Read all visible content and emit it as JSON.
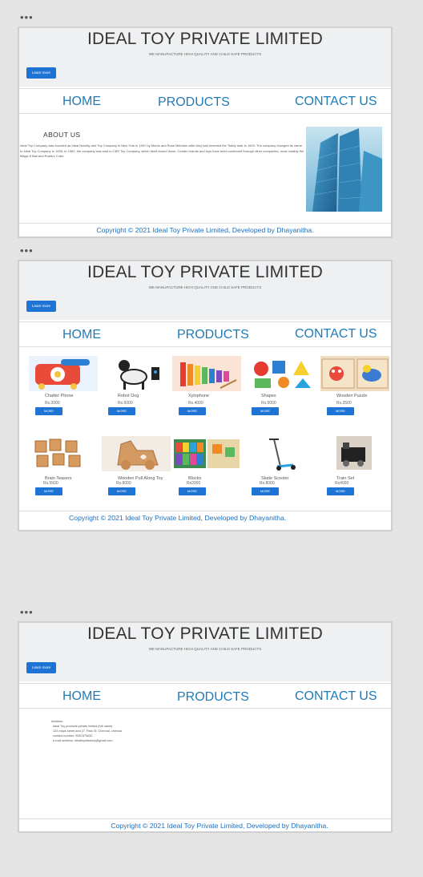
{
  "site": {
    "title": "IDEAL TOY PRIVATE LIMITED",
    "subtitle": "WE MANUFACTURE HIGH QUALITY AND CHILD SAFE PRODUCTS",
    "learn_more": "Learn more",
    "nav": {
      "home": "HOME",
      "products": "PRODUCTS",
      "contact": "CONTACT US"
    },
    "footer": "Copyright © 2021 Ideal Toy Private Limited, Developed by Dhayanitha."
  },
  "window_menu_icon": "more-dots-icon",
  "about": {
    "heading": "ABOUT US",
    "text": "Ideal Toy Company was founded as Ideal Novelty and Toy Company in New York in 1907 by Morris and Rose Michtom after they had invented the Teddy bear in 1903. The company changed its name to Ideal Toy Company in 1938. In 1982, the company was sold to CBS Toy Company, which itself closed down. Certain brands and toys have been continued through other companies, most notably the Magic 8 Ball and Rubik's Cube."
  },
  "products": [
    {
      "name": "Chatter Phone",
      "price": "Rs.2000",
      "more": "MORE",
      "icon": "toy-phone-icon"
    },
    {
      "name": "Robot Dog",
      "price": "Rs.5000",
      "more": "MORE",
      "icon": "robot-dog-icon"
    },
    {
      "name": "Xylophone",
      "price": "Rs.4000",
      "more": "MORE",
      "icon": "xylophone-icon"
    },
    {
      "name": "Shapes",
      "price": "Rs.5000",
      "more": "MORE",
      "icon": "shapes-icon"
    },
    {
      "name": "Wooden Puzzle",
      "price": "Rs.3500",
      "more": "MORE",
      "icon": "puzzle-icon"
    },
    {
      "name": "Brain Teasers",
      "price": "Rs.5500",
      "more": "MORE",
      "icon": "brain-teaser-icon"
    },
    {
      "name": "Wooden Pull Along Toy",
      "price": "Rs.8000",
      "more": "MORE",
      "icon": "pull-toy-icon"
    },
    {
      "name": "Blocks",
      "price": "Rs2000",
      "more": "MORE",
      "icon": "blocks-icon"
    },
    {
      "name": "Skate Scooter",
      "price": "Rs.8000",
      "more": "MORE",
      "icon": "scooter-icon"
    },
    {
      "name": "Train Set",
      "price": "Rs4000",
      "more": "MORE",
      "icon": "train-icon"
    }
  ],
  "contact": {
    "lines": [
      "Address:",
      "Ideal Toy products private limited (full name)",
      "123 maps street and 27, Park St. Chennai, chennai",
      "contact number: 9087675432",
      "e-mail address: idealtoysfactory@gmail.com"
    ]
  }
}
